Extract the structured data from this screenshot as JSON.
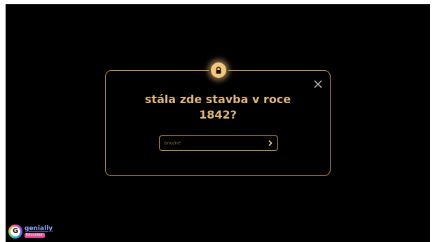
{
  "dialog": {
    "icon": "lock-icon",
    "question": "stála zde stavba v roce 1842?",
    "close_icon": "close-icon",
    "answer": {
      "value": "",
      "placeholder": "ano/ne",
      "submit_icon": "chevron-right-icon"
    }
  },
  "branding": {
    "logo_word": "genially",
    "logo_badge": "Education",
    "logo_letter": "G"
  },
  "colors": {
    "background": "#000000",
    "accent": "#e2b878",
    "border": "#b98e4e",
    "badge_glow": "#f2c77f"
  }
}
